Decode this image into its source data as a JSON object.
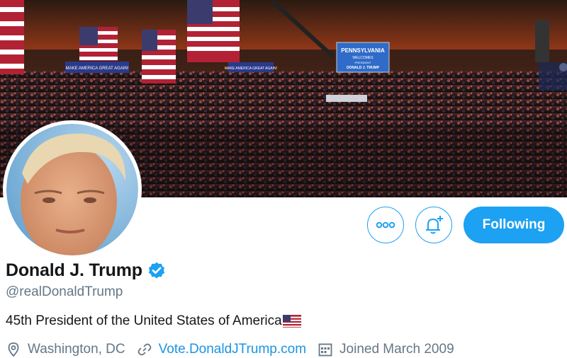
{
  "profile": {
    "name": "Donald J. Trump",
    "handle": "@realDonaldTrump",
    "bio": "45th President of the United States of America",
    "location": "Washington, DC",
    "website": "Vote.DonaldJTrump.com",
    "joined": "Joined March 2009",
    "verified": true
  },
  "actions": {
    "following_label": "Following",
    "more_icon": "more-icon",
    "notify_icon": "bell-plus-icon"
  },
  "banner": {
    "signs": [
      "MAKE AMERICA GREAT AGAIN!",
      "MAKE AMERICA GREAT AGAIN!",
      "PENNSYLVANIA",
      "WELCOMES",
      "PRESIDENT",
      "DONALD J. TRUMP"
    ]
  },
  "colors": {
    "accent": "#1da1f2",
    "link": "#1b95e0",
    "secondary_text": "#657786"
  }
}
